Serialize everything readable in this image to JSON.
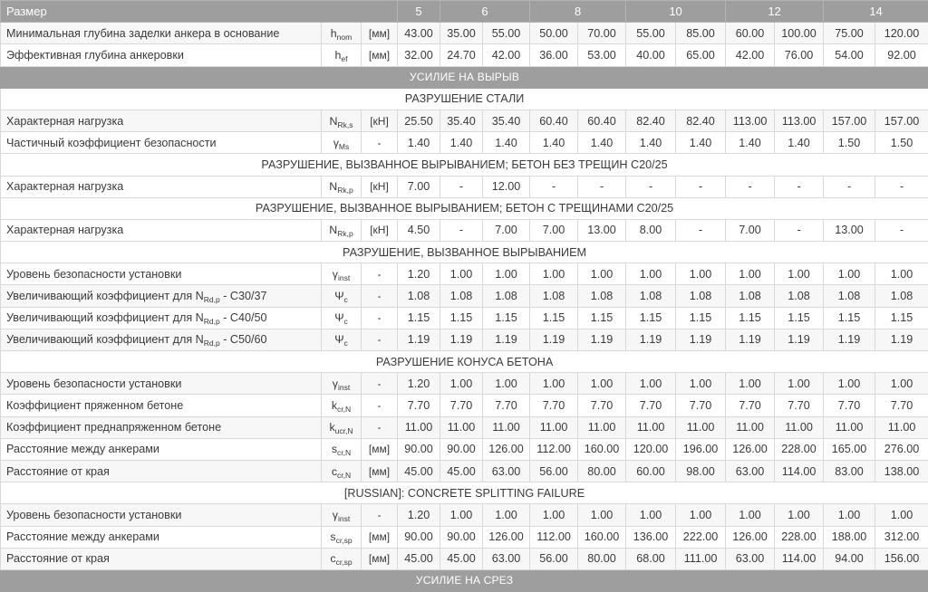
{
  "table": {
    "size_label": "Размер",
    "sizes": [
      "5",
      "6",
      "8",
      "10",
      "12",
      "14"
    ],
    "rows": [
      {
        "type": "row",
        "label": "Минимальная глубина заделки анкера в основание",
        "sym": "h",
        "sub": "nom",
        "unit": "[мм]",
        "values": [
          "43.00",
          "35.00",
          "55.00",
          "50.00",
          "70.00",
          "55.00",
          "85.00",
          "60.00",
          "100.00",
          "75.00",
          "120.00"
        ]
      },
      {
        "type": "row",
        "label": "Эффективная глубина анкеровки",
        "sym": "h",
        "sub": "ef",
        "unit": "[мм]",
        "values": [
          "32.00",
          "24.70",
          "42.00",
          "36.00",
          "53.00",
          "40.00",
          "65.00",
          "42.00",
          "76.00",
          "54.00",
          "92.00"
        ]
      },
      {
        "type": "band",
        "label": "УСИЛИЕ НА ВЫРЫВ"
      },
      {
        "type": "section",
        "label": "РАЗРУШЕНИЕ СТАЛИ"
      },
      {
        "type": "row",
        "label": "Характерная нагрузка",
        "sym": "N",
        "sub": "Rk,s",
        "unit": "[кН]",
        "values": [
          "25.50",
          "35.40",
          "35.40",
          "60.40",
          "60.40",
          "82.40",
          "82.40",
          "113.00",
          "113.00",
          "157.00",
          "157.00"
        ]
      },
      {
        "type": "row",
        "label": "Частичный коэффициент безопасности",
        "sym": "γ",
        "sub": "Ms",
        "unit": "-",
        "values": [
          "1.40",
          "1.40",
          "1.40",
          "1.40",
          "1.40",
          "1.40",
          "1.40",
          "1.40",
          "1.40",
          "1.50",
          "1.50"
        ]
      },
      {
        "type": "section",
        "label": "РАЗРУШЕНИЕ, ВЫЗВАННОЕ ВЫРЫВАНИЕМ; БЕТОН БЕЗ ТРЕЩИН С20/25"
      },
      {
        "type": "row",
        "label": "Характерная нагрузка",
        "sym": "N",
        "sub": "Rk,p",
        "unit": "[кН]",
        "values": [
          "7.00",
          "-",
          "12.00",
          "-",
          "-",
          "-",
          "-",
          "-",
          "-",
          "-",
          "-"
        ]
      },
      {
        "type": "section",
        "label": "РАЗРУШЕНИЕ, ВЫЗВАННОЕ ВЫРЫВАНИЕМ; БЕТОН С ТРЕЩИНАМИ С20/25"
      },
      {
        "type": "row",
        "label": "Характерная нагрузка",
        "sym": "N",
        "sub": "Rk,p",
        "unit": "[кН]",
        "values": [
          "4.50",
          "-",
          "7.00",
          "7.00",
          "13.00",
          "8.00",
          "-",
          "7.00",
          "-",
          "13.00",
          "-"
        ]
      },
      {
        "type": "section",
        "label": "РАЗРУШЕНИЕ, ВЫЗВАННОЕ ВЫРЫВАНИЕМ"
      },
      {
        "type": "row",
        "label": "Уровень безопасности установки",
        "sym": "γ",
        "sub": "inst",
        "unit": "-",
        "values": [
          "1.20",
          "1.00",
          "1.00",
          "1.00",
          "1.00",
          "1.00",
          "1.00",
          "1.00",
          "1.00",
          "1.00",
          "1.00"
        ]
      },
      {
        "type": "row",
        "label": "Увеличивающий коэффициент для N",
        "label_sub": "Rd,p",
        "label_tail": " - С30/37",
        "sym": "Ψ",
        "sub": "c",
        "unit": "-",
        "values": [
          "1.08",
          "1.08",
          "1.08",
          "1.08",
          "1.08",
          "1.08",
          "1.08",
          "1.08",
          "1.08",
          "1.08",
          "1.08"
        ]
      },
      {
        "type": "row",
        "label": "Увеличивающий коэффициент для N",
        "label_sub": "Rd,p",
        "label_tail": " - С40/50",
        "sym": "Ψ",
        "sub": "c",
        "unit": "-",
        "values": [
          "1.15",
          "1.15",
          "1.15",
          "1.15",
          "1.15",
          "1.15",
          "1.15",
          "1.15",
          "1.15",
          "1.15",
          "1.15"
        ]
      },
      {
        "type": "row",
        "label": "Увеличивающий коэффициент для N",
        "label_sub": "Rd,p",
        "label_tail": " - С50/60",
        "sym": "Ψ",
        "sub": "c",
        "unit": "-",
        "values": [
          "1.19",
          "1.19",
          "1.19",
          "1.19",
          "1.19",
          "1.19",
          "1.19",
          "1.19",
          "1.19",
          "1.19",
          "1.19"
        ]
      },
      {
        "type": "section",
        "label": "РАЗРУШЕНИЕ КОНУСА БЕТОНА"
      },
      {
        "type": "row",
        "label": "Уровень безопасности установки",
        "sym": "γ",
        "sub": "inst",
        "unit": "-",
        "values": [
          "1.20",
          "1.00",
          "1.00",
          "1.00",
          "1.00",
          "1.00",
          "1.00",
          "1.00",
          "1.00",
          "1.00",
          "1.00"
        ]
      },
      {
        "type": "row",
        "label": "Коэффициент пряженном бетоне",
        "sym": "k",
        "sub": "cr,N",
        "unit": "-",
        "values": [
          "7.70",
          "7.70",
          "7.70",
          "7.70",
          "7.70",
          "7.70",
          "7.70",
          "7.70",
          "7.70",
          "7.70",
          "7.70"
        ]
      },
      {
        "type": "row",
        "label": "Коэффициент преднапряженном бетоне",
        "sym": "k",
        "sub": "ucr,N",
        "unit": "-",
        "values": [
          "11.00",
          "11.00",
          "11.00",
          "11.00",
          "11.00",
          "11.00",
          "11.00",
          "11.00",
          "11.00",
          "11.00",
          "11.00"
        ]
      },
      {
        "type": "row",
        "label": "Расстояние между анкерами",
        "sym": "s",
        "sub": "cr,N",
        "unit": "[мм]",
        "values": [
          "90.00",
          "90.00",
          "126.00",
          "112.00",
          "160.00",
          "120.00",
          "196.00",
          "126.00",
          "228.00",
          "165.00",
          "276.00"
        ]
      },
      {
        "type": "row",
        "label": "Расстояние от края",
        "sym": "c",
        "sub": "cr,N",
        "unit": "[мм]",
        "values": [
          "45.00",
          "45.00",
          "63.00",
          "56.00",
          "80.00",
          "60.00",
          "98.00",
          "63.00",
          "114.00",
          "83.00",
          "138.00"
        ]
      },
      {
        "type": "section",
        "label": "[RUSSIAN]: CONCRETE SPLITTING FAILURE"
      },
      {
        "type": "row",
        "label": "Уровень безопасности установки",
        "sym": "γ",
        "sub": "inst",
        "unit": "-",
        "values": [
          "1.20",
          "1.00",
          "1.00",
          "1.00",
          "1.00",
          "1.00",
          "1.00",
          "1.00",
          "1.00",
          "1.00",
          "1.00"
        ]
      },
      {
        "type": "row",
        "label": "Расстояние между анкерами",
        "sym": "s",
        "sub": "cr,sp",
        "unit": "[мм]",
        "values": [
          "90.00",
          "90.00",
          "126.00",
          "112.00",
          "160.00",
          "136.00",
          "222.00",
          "126.00",
          "228.00",
          "188.00",
          "312.00"
        ]
      },
      {
        "type": "row",
        "label": "Расстояние от края",
        "sym": "c",
        "sub": "cr,sp",
        "unit": "[мм]",
        "values": [
          "45.00",
          "45.00",
          "63.00",
          "56.00",
          "80.00",
          "68.00",
          "111.00",
          "63.00",
          "114.00",
          "94.00",
          "156.00"
        ]
      },
      {
        "type": "band",
        "label": "УСИЛИЕ НА СРЕЗ"
      }
    ]
  }
}
